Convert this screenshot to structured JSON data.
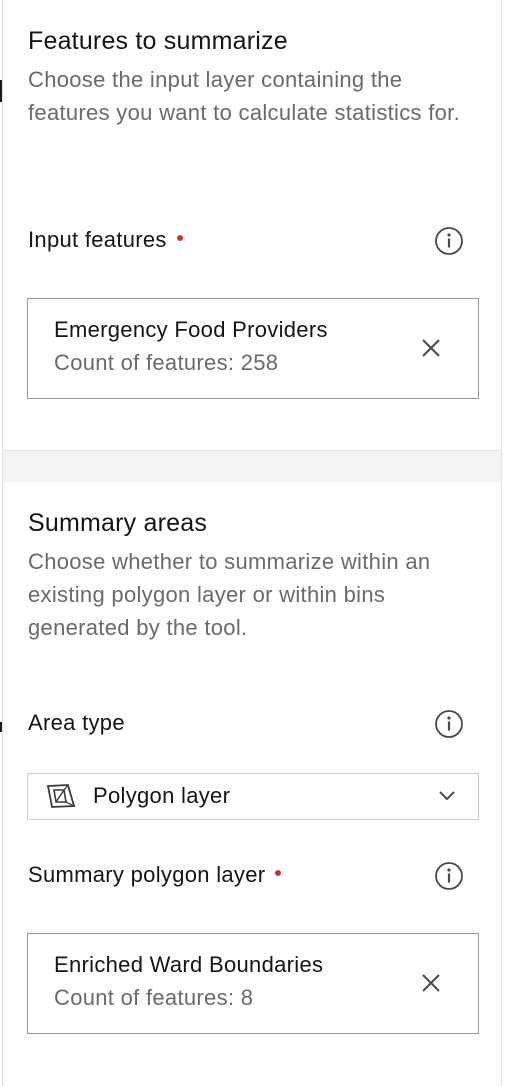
{
  "features_section": {
    "title": "Features to summarize",
    "description": "Choose the input layer containing the features you want to calculate statistics for.",
    "input_label": "Input features",
    "input_required": true,
    "info_icon": "info-icon",
    "input_layer": {
      "name": "Emergency Food Providers",
      "count": "Count of features: 258",
      "remove_icon": "close-icon"
    }
  },
  "summary_section": {
    "title": "Summary areas",
    "description": "Choose whether to summarize within an existing polygon layer or within bins generated by the tool.",
    "area_type_label": "Area type",
    "area_type_value": "Polygon layer",
    "area_type_icon": "polygon-layer-icon",
    "dropdown_icon": "chevron-down-icon",
    "polygon_layer_label": "Summary polygon layer",
    "polygon_layer_required": true,
    "polygon_layer": {
      "name": "Enriched Ward Boundaries",
      "count": "Count of features: 8",
      "remove_icon": "close-icon"
    }
  },
  "colors": {
    "required": "#c33b2b",
    "text": "#151515",
    "secondary_text": "#6a6a6a",
    "border": "#9a9a9a",
    "band": "#f4f4f4"
  }
}
